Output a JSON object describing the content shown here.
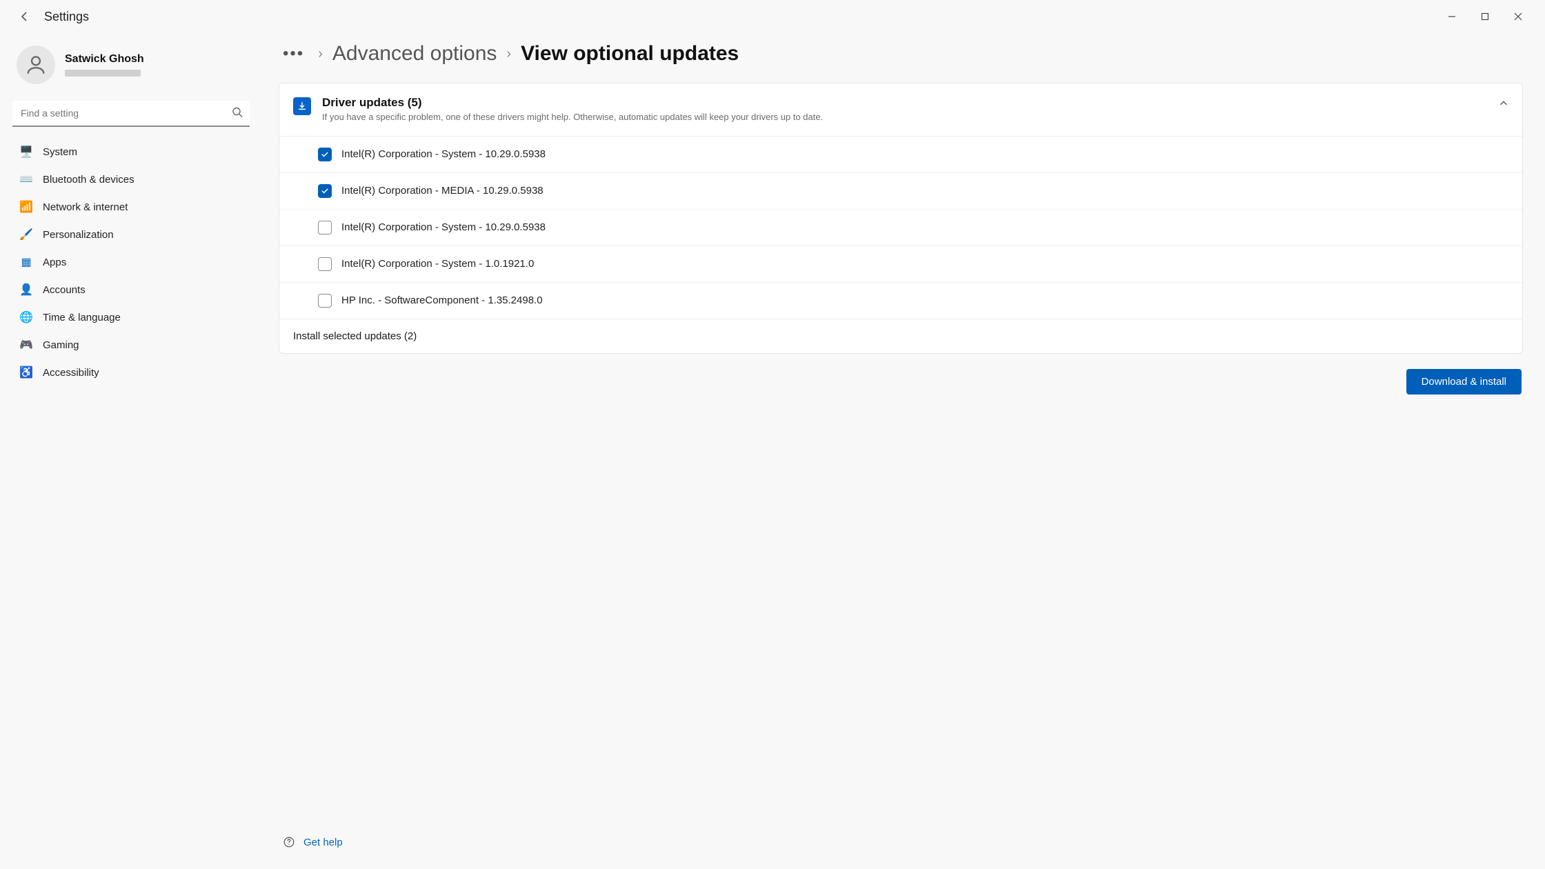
{
  "app": {
    "title": "Settings"
  },
  "user": {
    "name": "Satwick Ghosh"
  },
  "search": {
    "placeholder": "Find a setting"
  },
  "sidebar": {
    "items": [
      {
        "label": "System",
        "icon": "🖥️",
        "color": "#0067c0"
      },
      {
        "label": "Bluetooth & devices",
        "icon": "⌨️",
        "color": "#0067c0"
      },
      {
        "label": "Network & internet",
        "icon": "📶",
        "color": "#5a5a5a"
      },
      {
        "label": "Personalization",
        "icon": "🖌️",
        "color": "#c94f7c"
      },
      {
        "label": "Apps",
        "icon": "▦",
        "color": "#0067c0"
      },
      {
        "label": "Accounts",
        "icon": "👤",
        "color": "#c06a2b"
      },
      {
        "label": "Time & language",
        "icon": "🌐",
        "color": "#0067c0"
      },
      {
        "label": "Gaming",
        "icon": "🎮",
        "color": "#5a5a5a"
      },
      {
        "label": "Accessibility",
        "icon": "♿",
        "color": "#0067c0"
      }
    ]
  },
  "breadcrumb": {
    "prev": "Advanced options",
    "current": "View optional updates"
  },
  "panel": {
    "title": "Driver updates (5)",
    "subtitle": "If you have a specific problem, one of these drivers might help. Otherwise, automatic updates will keep your drivers up to date."
  },
  "updates": [
    {
      "label": "Intel(R) Corporation - System - 10.29.0.5938",
      "checked": true
    },
    {
      "label": "Intel(R) Corporation - MEDIA - 10.29.0.5938",
      "checked": true
    },
    {
      "label": "Intel(R) Corporation - System - 10.29.0.5938",
      "checked": false
    },
    {
      "label": "Intel(R) Corporation - System - 1.0.1921.0",
      "checked": false
    },
    {
      "label": "HP Inc. - SoftwareComponent - 1.35.2498.0",
      "checked": false
    }
  ],
  "selected": {
    "label": "Install selected updates (2)"
  },
  "actions": {
    "download_install": "Download & install"
  },
  "help": {
    "label": "Get help"
  }
}
